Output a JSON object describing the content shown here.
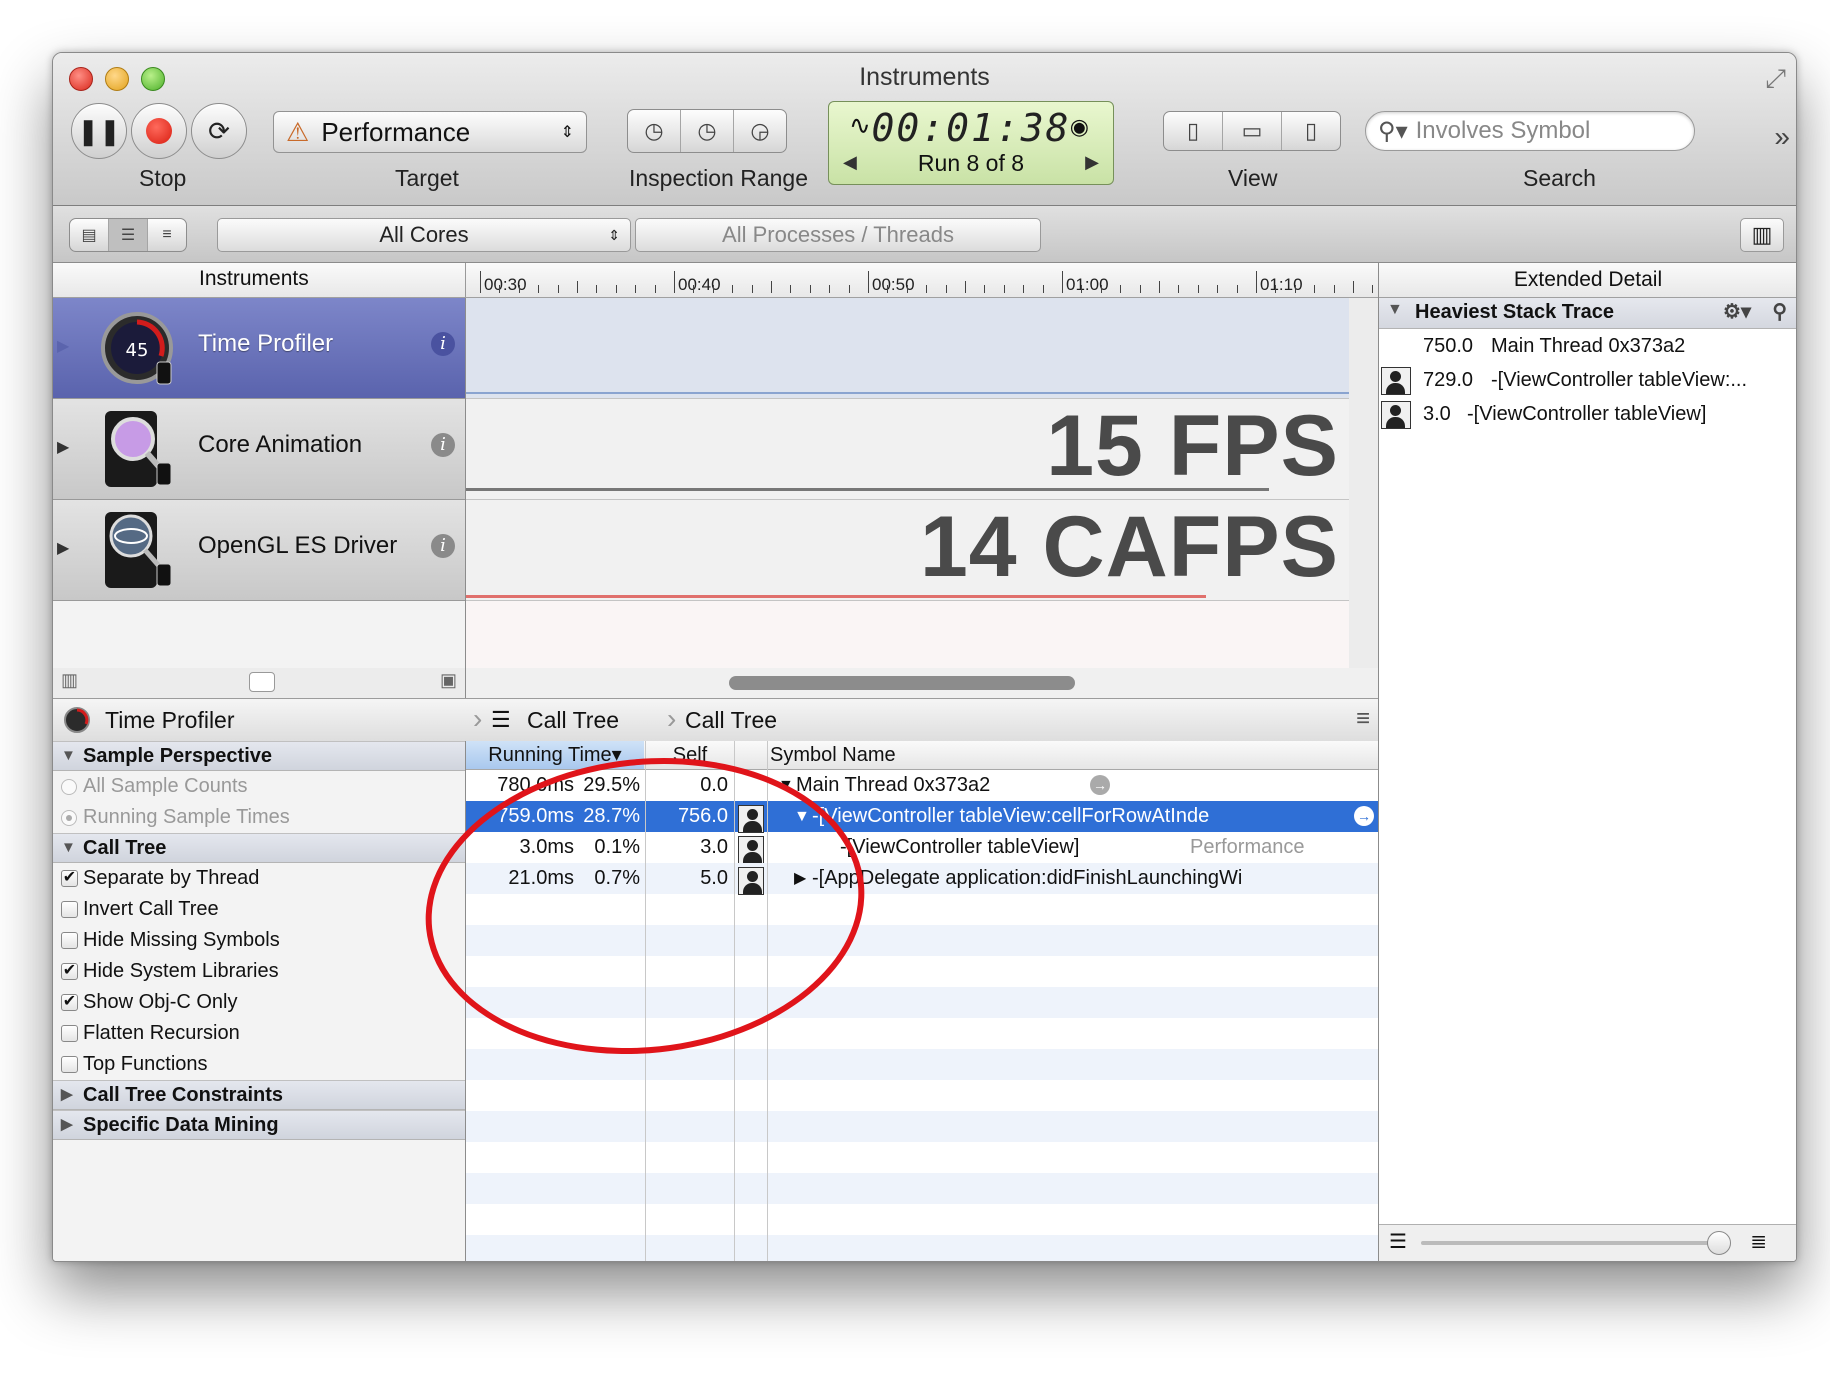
{
  "window": {
    "title": "Instruments"
  },
  "toolbar": {
    "stop_label": "Stop",
    "target_label": "Target",
    "target_value": "Performance",
    "inspection_label": "Inspection Range",
    "timer": "00:01:38",
    "run": "Run 8 of 8",
    "view_label": "View",
    "search_label": "Search",
    "search_placeholder": "Involves Symbol"
  },
  "filterbar": {
    "cores": "All Cores",
    "processes": "All Processes / Threads"
  },
  "timeline": {
    "header": "Instruments",
    "ticks": [
      "00:30",
      "00:40",
      "00:50",
      "01:00",
      "01:10"
    ]
  },
  "instruments": [
    {
      "name": "Time Profiler",
      "selected": true,
      "icon": "stopwatch-icon"
    },
    {
      "name": "Core Animation",
      "selected": false,
      "icon": "magnifier-icon"
    },
    {
      "name": "OpenGL ES Driver",
      "selected": false,
      "icon": "opengl-icon"
    }
  ],
  "tracks": {
    "fps": "15 FPS",
    "cafps": "14 CAFPS"
  },
  "extended_detail": {
    "title": "Extended Detail",
    "section": "Heaviest Stack Trace",
    "rows": [
      {
        "count": "750.0",
        "symbol": "Main Thread  0x373a2",
        "icon": false
      },
      {
        "count": "729.0",
        "symbol": "-[ViewController tableView:...",
        "icon": true
      },
      {
        "count": "3.0",
        "symbol": "-[ViewController tableView]",
        "icon": true
      }
    ]
  },
  "detail": {
    "instrument": "Time Profiler",
    "crumb1": "Call Tree",
    "crumb2": "Call Tree"
  },
  "side_panel": {
    "sample_perspective": "Sample Perspective",
    "all_sample_counts": "All Sample Counts",
    "running_sample_times": "Running Sample Times",
    "call_tree": "Call Tree",
    "options": [
      {
        "label": "Separate by Thread",
        "checked": true
      },
      {
        "label": "Invert Call Tree",
        "checked": false
      },
      {
        "label": "Hide Missing Symbols",
        "checked": false
      },
      {
        "label": "Hide System Libraries",
        "checked": true
      },
      {
        "label": "Show Obj-C Only",
        "checked": true
      },
      {
        "label": "Flatten Recursion",
        "checked": false
      },
      {
        "label": "Top Functions",
        "checked": false
      }
    ],
    "constraints": "Call Tree Constraints",
    "data_mining": "Specific Data Mining"
  },
  "table": {
    "headers": {
      "running_time": "Running Time▾",
      "self": "Self",
      "symbol": "Symbol Name"
    },
    "rows": [
      {
        "time": "780.0ms",
        "pct": "29.5%",
        "self": "0.0",
        "symbol": "Main Thread  0x373a2",
        "library": "",
        "disclosure": "▼",
        "selected": false,
        "user": false
      },
      {
        "time": "759.0ms",
        "pct": "28.7%",
        "self": "756.0",
        "symbol": "-[ViewController tableView:cellForRowAtInde",
        "library": "",
        "disclosure": "▼",
        "selected": true,
        "user": true
      },
      {
        "time": "3.0ms",
        "pct": "0.1%",
        "self": "3.0",
        "symbol": "-[ViewController tableView]",
        "library": "Performance",
        "disclosure": "",
        "selected": false,
        "user": true
      },
      {
        "time": "21.0ms",
        "pct": "0.7%",
        "self": "5.0",
        "symbol": "-[AppDelegate application:didFinishLaunchingWi",
        "library": "",
        "disclosure": "▶",
        "selected": false,
        "user": true
      }
    ]
  },
  "colors": {
    "selection": "#2f6fd6",
    "annotation": "#e0141a",
    "instrument_selected": "#6b74bb"
  }
}
